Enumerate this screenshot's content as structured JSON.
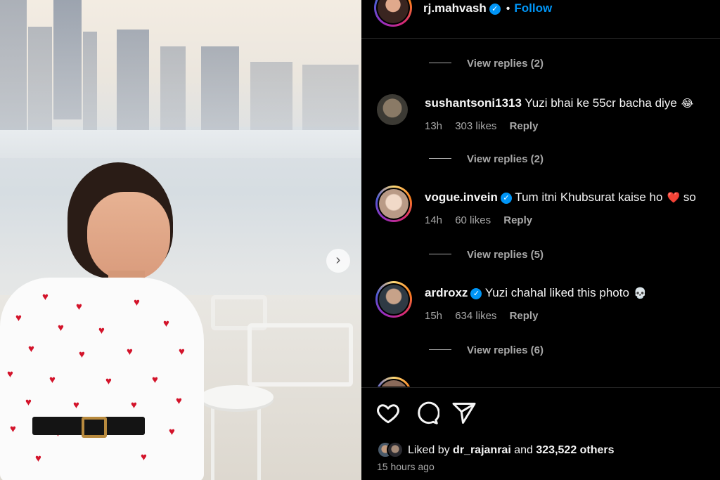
{
  "post": {
    "username": "rj.mahvash",
    "separator": "•",
    "follow_label": "Follow",
    "next_icon": "chevron-right-icon"
  },
  "comments": [
    {
      "view_replies": "View replies (2)"
    },
    {
      "username": "sushantsoni1313",
      "verified": false,
      "text": "Yuzi bhai ke 55cr bacha diye",
      "emoji": "😂",
      "time": "13h",
      "likes": "303 likes",
      "reply": "Reply",
      "view_replies": "View replies (2)"
    },
    {
      "username": "vogue.invein",
      "verified": true,
      "text": "Tum itni Khubsurat kaise ho",
      "emoji": "❤️",
      "trail": "so",
      "time": "14h",
      "likes": "60 likes",
      "reply": "Reply",
      "view_replies": "View replies (5)"
    },
    {
      "username": "ardroxz",
      "verified": true,
      "text": "Yuzi chahal liked this photo",
      "emoji": "💀",
      "time": "15h",
      "likes": "634 likes",
      "reply": "Reply",
      "view_replies": "View replies (6)"
    }
  ],
  "actions": {
    "like_icon": "heart-icon",
    "comment_icon": "comment-icon",
    "share_icon": "send-icon",
    "liked_by_prefix": "Liked by",
    "liked_by_user": "dr_rajanrai",
    "liked_by_and": "and",
    "liked_by_count": "323,522 others",
    "time_ago": "15 hours ago"
  },
  "colors": {
    "accent": "#0095f6",
    "background": "#000000",
    "muted_text": "#a8a8a8",
    "heart": "#d3132a"
  }
}
